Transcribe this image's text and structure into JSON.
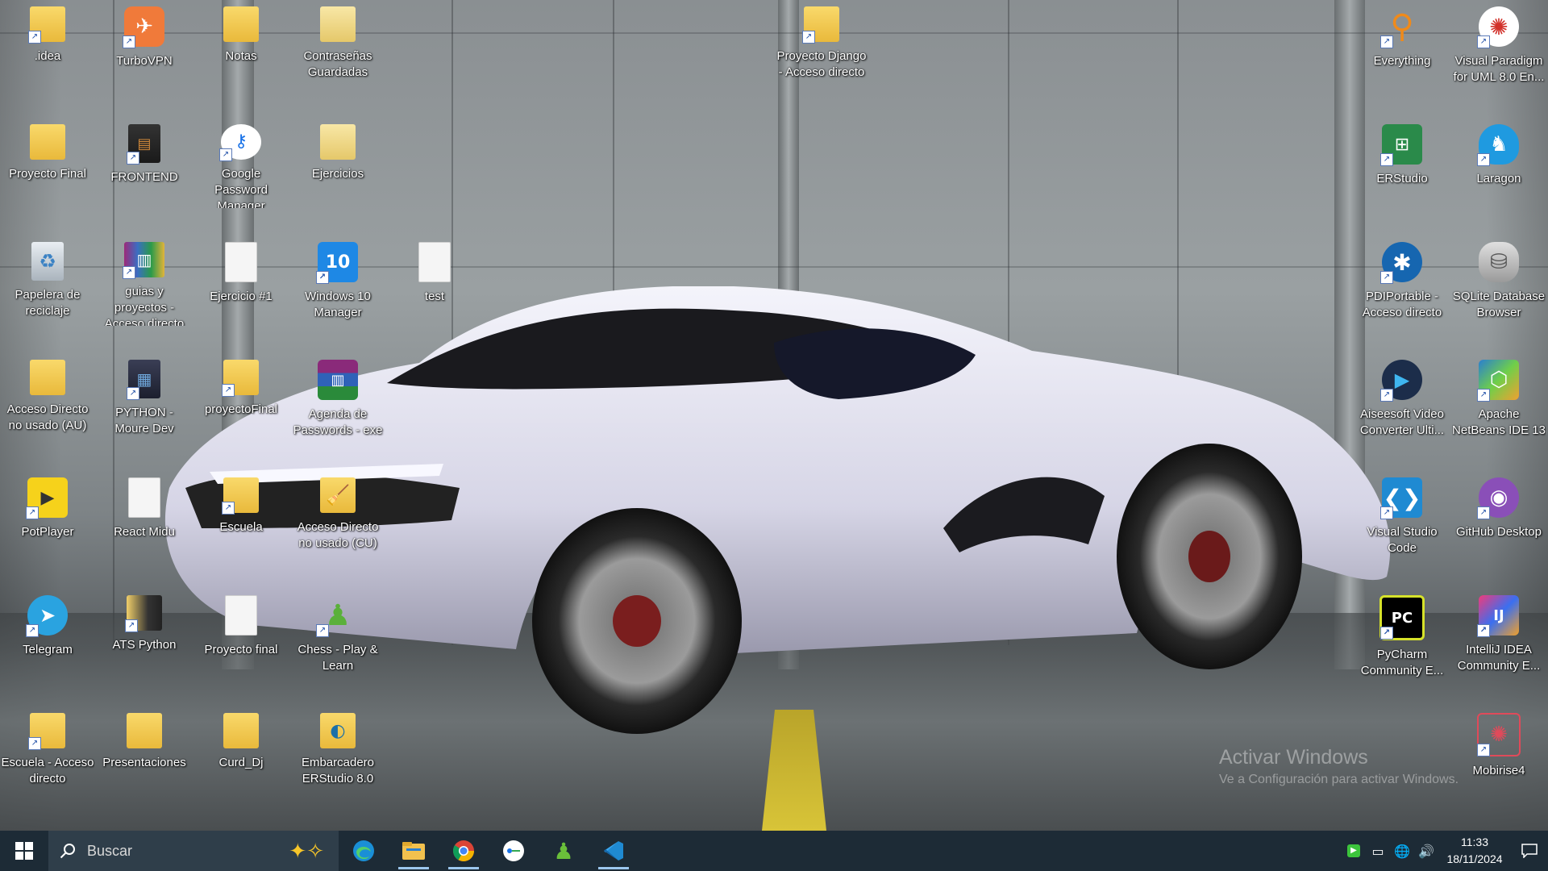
{
  "desktop": {
    "icons": [
      {
        "label": ".idea",
        "icon": "folder-shortcut-icon"
      },
      {
        "label": "TurboVPN",
        "icon": "turbovpn-icon"
      },
      {
        "label": "Notas",
        "icon": "folder-icon"
      },
      {
        "label": "Contraseñas Guardadas",
        "icon": "folder-icon"
      },
      {
        "label": "Proyecto Django - Acceso directo",
        "icon": "folder-shortcut-icon"
      },
      {
        "label": "Everything",
        "icon": "everything-search-icon"
      },
      {
        "label": "Visual Paradigm for UML 8.0 En...",
        "icon": "visual-paradigm-icon"
      },
      {
        "label": "Proyecto Final",
        "icon": "folder-icon"
      },
      {
        "label": "FRONTEND",
        "icon": "frontend-shortcut-icon"
      },
      {
        "label": "Google Password Manager",
        "icon": "google-password-manager-icon"
      },
      {
        "label": "Ejercicios",
        "icon": "folder-icon"
      },
      {
        "label": "ERStudio",
        "icon": "erstudio-icon"
      },
      {
        "label": "Laragon",
        "icon": "laragon-icon"
      },
      {
        "label": "Papelera de reciclaje",
        "icon": "recycle-bin-icon"
      },
      {
        "label": "guias y proyectos - Acceso directo",
        "icon": "archive-shortcut-icon"
      },
      {
        "label": "Ejercicio #1",
        "icon": "file-icon"
      },
      {
        "label": "Windows 10 Manager",
        "icon": "windows10-manager-icon"
      },
      {
        "label": "test",
        "icon": "file-icon"
      },
      {
        "label": "PDIPortable - Acceso directo",
        "icon": "pdiportable-icon"
      },
      {
        "label": "SQLite Database Browser",
        "icon": "sqlite-browser-icon"
      },
      {
        "label": "Acceso Directo no usado (AU)",
        "icon": "folder-icon"
      },
      {
        "label": "PYTHON - Moure Dev",
        "icon": "python-shortcut-icon"
      },
      {
        "label": "proyectoFinal",
        "icon": "folder-shortcut-icon"
      },
      {
        "label": "Agenda de Passwords - exe",
        "icon": "winrar-icon"
      },
      {
        "label": "Aiseesoft Video Converter Ulti...",
        "icon": "aiseesoft-icon"
      },
      {
        "label": "Apache NetBeans IDE 13",
        "icon": "netbeans-icon"
      },
      {
        "label": "PotPlayer",
        "icon": "potplayer-icon"
      },
      {
        "label": "React Midu",
        "icon": "file-icon"
      },
      {
        "label": "Escuela",
        "icon": "folder-shortcut-icon"
      },
      {
        "label": "Acceso Directo no usado (CU)",
        "icon": "folder-broom-icon"
      },
      {
        "label": "Visual Studio Code",
        "icon": "vscode-icon"
      },
      {
        "label": "GitHub Desktop",
        "icon": "github-desktop-icon"
      },
      {
        "label": "Telegram",
        "icon": "telegram-icon"
      },
      {
        "label": "ATS Python",
        "icon": "folder-shortcut-icon"
      },
      {
        "label": "Proyecto final",
        "icon": "file-icon"
      },
      {
        "label": "Chess - Play & Learn",
        "icon": "chess-icon"
      },
      {
        "label": "PyCharm Community E...",
        "icon": "pycharm-icon"
      },
      {
        "label": "IntelliJ IDEA Community E...",
        "icon": "intellij-icon"
      },
      {
        "label": "Escuela - Acceso directo",
        "icon": "folder-shortcut-icon"
      },
      {
        "label": "Presentaciones",
        "icon": "folder-icon"
      },
      {
        "label": "Curd_Dj",
        "icon": "folder-icon"
      },
      {
        "label": "Embarcadero ERStudio 8.0",
        "icon": "embarcadero-icon"
      },
      {
        "label": "Mobirise4",
        "icon": "mobirise-icon"
      }
    ]
  },
  "watermark": {
    "title": "Activar Windows",
    "subtitle": "Ve a Configuración para activar Windows."
  },
  "taskbar": {
    "search_placeholder": "Buscar",
    "apps": [
      "edge-icon",
      "file-explorer-icon",
      "chrome-icon",
      "google-password-manager-icon",
      "chess-icon",
      "vscode-icon"
    ],
    "tray_icons": [
      "media-play-icon",
      "battery-icon",
      "network-globe-icon",
      "volume-icon"
    ],
    "time": "11:33",
    "date": "18/11/2024"
  },
  "colors": {
    "taskbar_bg": "#1d2b36",
    "search_bg": "#2f3e4a",
    "accent": "#0078d4"
  }
}
